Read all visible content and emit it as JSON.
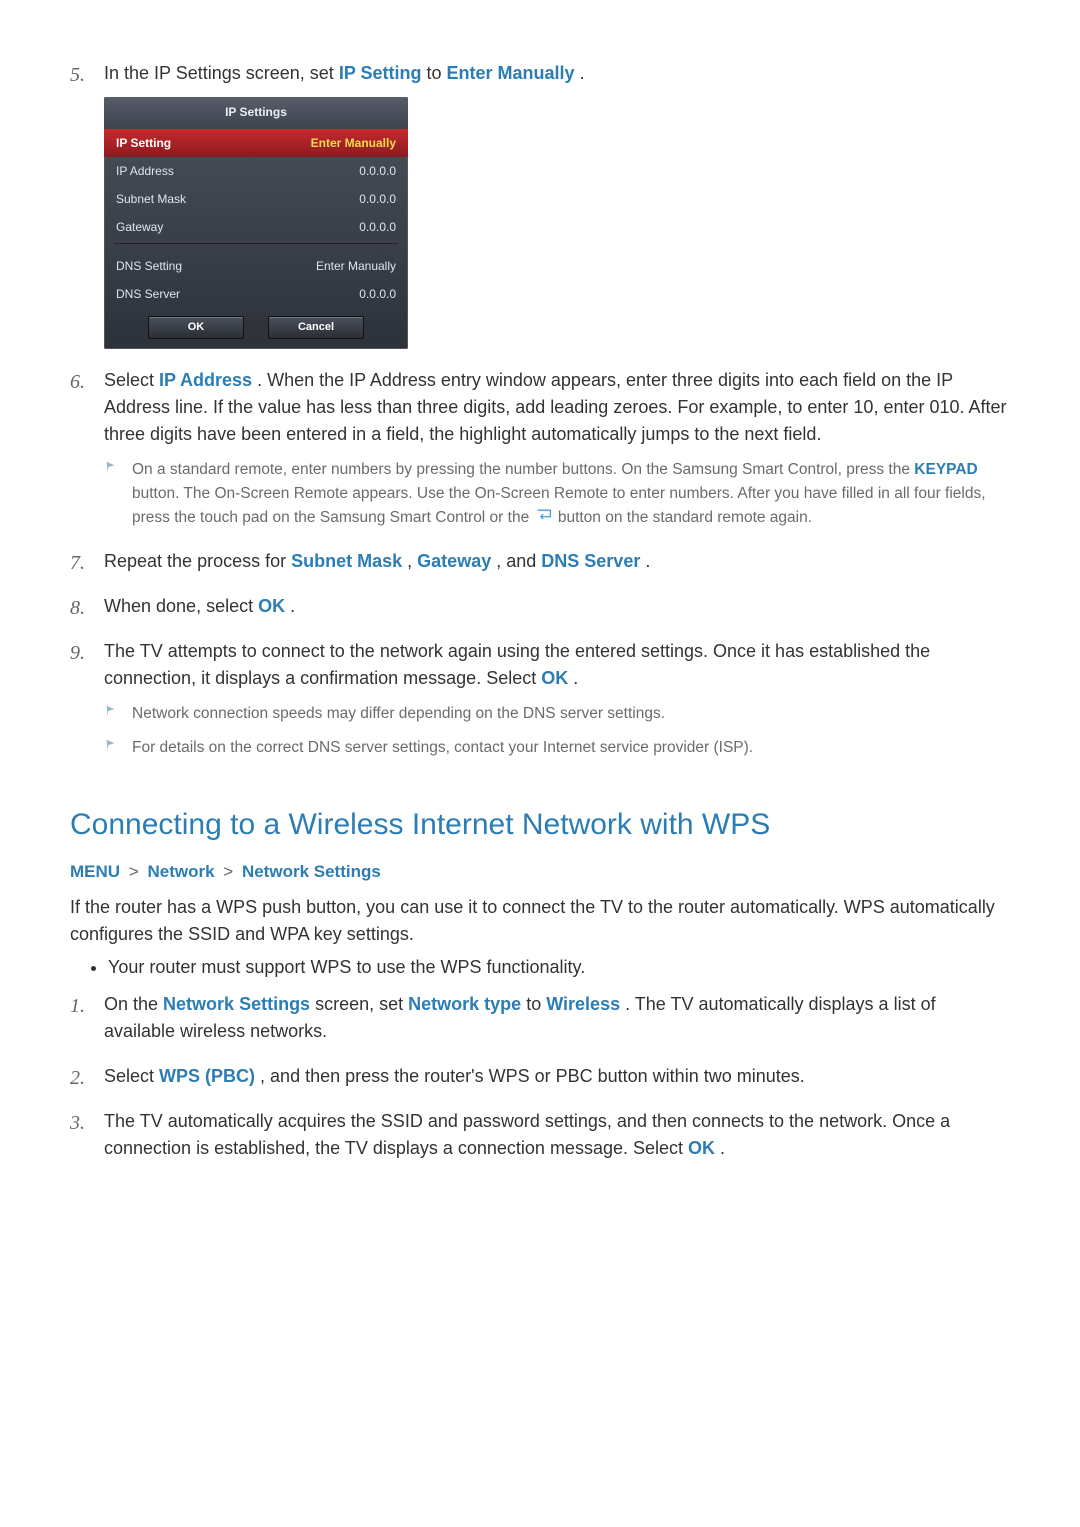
{
  "step5": {
    "num": "5.",
    "pre": "In the IP Settings screen, set ",
    "kw1": "IP Setting",
    "mid": " to ",
    "kw2": "Enter Manually",
    "post": "."
  },
  "panel": {
    "title": "IP Settings",
    "selected": {
      "label": "IP Setting",
      "value": "Enter Manually"
    },
    "rows1": [
      {
        "label": "IP Address",
        "value": "0.0.0.0"
      },
      {
        "label": "Subnet Mask",
        "value": "0.0.0.0"
      },
      {
        "label": "Gateway",
        "value": "0.0.0.0"
      }
    ],
    "rows2": [
      {
        "label": "DNS Setting",
        "value": "Enter Manually"
      },
      {
        "label": "DNS Server",
        "value": "0.0.0.0"
      }
    ],
    "ok": "OK",
    "cancel": "Cancel"
  },
  "step6": {
    "num": "6.",
    "pre": "Select ",
    "kw": "IP Address",
    "post": ". When the IP Address entry window appears, enter three digits into each field on the IP Address line. If the value has less than three digits, add leading zeroes. For example, to enter 10, enter 010. After three digits have been entered in a field, the highlight automatically jumps to the next field.",
    "note_a": "On a standard remote, enter numbers by pressing the number buttons. On the Samsung Smart Control, press the ",
    "note_kw": "KEYPAD",
    "note_b": " button. The On-Screen Remote appears. Use the On-Screen Remote to enter numbers. After you have filled in all four fields, press the touch pad on the Samsung Smart Control or the ",
    "note_c": " button on the standard remote again."
  },
  "step7": {
    "num": "7.",
    "pre": "Repeat the process for ",
    "kw1": "Subnet Mask",
    "sep1": ", ",
    "kw2": "Gateway",
    "sep2": ", and ",
    "kw3": "DNS Server",
    "post": "."
  },
  "step8": {
    "num": "8.",
    "pre": "When done, select ",
    "kw": "OK",
    "post": "."
  },
  "step9": {
    "num": "9.",
    "text_a": "The TV attempts to connect to the network again using the entered settings. Once it has established the connection, it displays a confirmation message. Select ",
    "kw": "OK",
    "text_b": ".",
    "note1": "Network connection speeds may differ depending on the DNS server settings.",
    "note2": "For details on the correct DNS server settings, contact your Internet service provider (ISP)."
  },
  "wps": {
    "heading": "Connecting to a Wireless Internet Network with WPS",
    "bc": {
      "a": "MENU",
      "b": "Network",
      "c": "Network Settings",
      "sep": ">"
    },
    "intro": "If the router has a WPS push button, you can use it to connect the TV to the router automatically. WPS automatically configures the SSID and WPA key settings.",
    "bullet": "Your router must support WPS to use the WPS functionality.",
    "s1": {
      "num": "1.",
      "pre": "On the ",
      "kw1": "Network Settings",
      "mid": " screen, set ",
      "kw2": "Network type",
      "mid2": " to ",
      "kw3": "Wireless",
      "post": ". The TV automatically displays a list of available wireless networks."
    },
    "s2": {
      "num": "2.",
      "pre": "Select ",
      "kw": "WPS (PBC)",
      "post": ", and then press the router's WPS or PBC button within two minutes."
    },
    "s3": {
      "num": "3.",
      "pre": "The TV automatically acquires the SSID and password settings, and then connects to the network. Once a connection is established, the TV displays a connection message. Select ",
      "kw": "OK",
      "post": "."
    }
  }
}
